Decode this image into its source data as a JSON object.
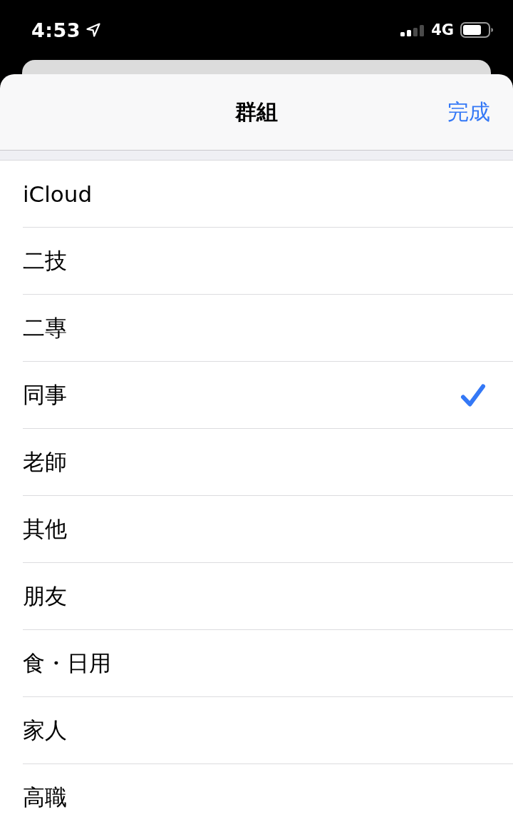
{
  "status_bar": {
    "time": "4:53",
    "network": "4G"
  },
  "sheet": {
    "title": "群組",
    "done_button": "完成"
  },
  "groups": [
    {
      "label": "iCloud",
      "selected": false
    },
    {
      "label": "二技",
      "selected": false
    },
    {
      "label": "二專",
      "selected": false
    },
    {
      "label": "同事",
      "selected": true
    },
    {
      "label": "老師",
      "selected": false
    },
    {
      "label": "其他",
      "selected": false
    },
    {
      "label": "朋友",
      "selected": false
    },
    {
      "label": "食・日用",
      "selected": false
    },
    {
      "label": "家人",
      "selected": false
    },
    {
      "label": "高職",
      "selected": false
    }
  ]
}
